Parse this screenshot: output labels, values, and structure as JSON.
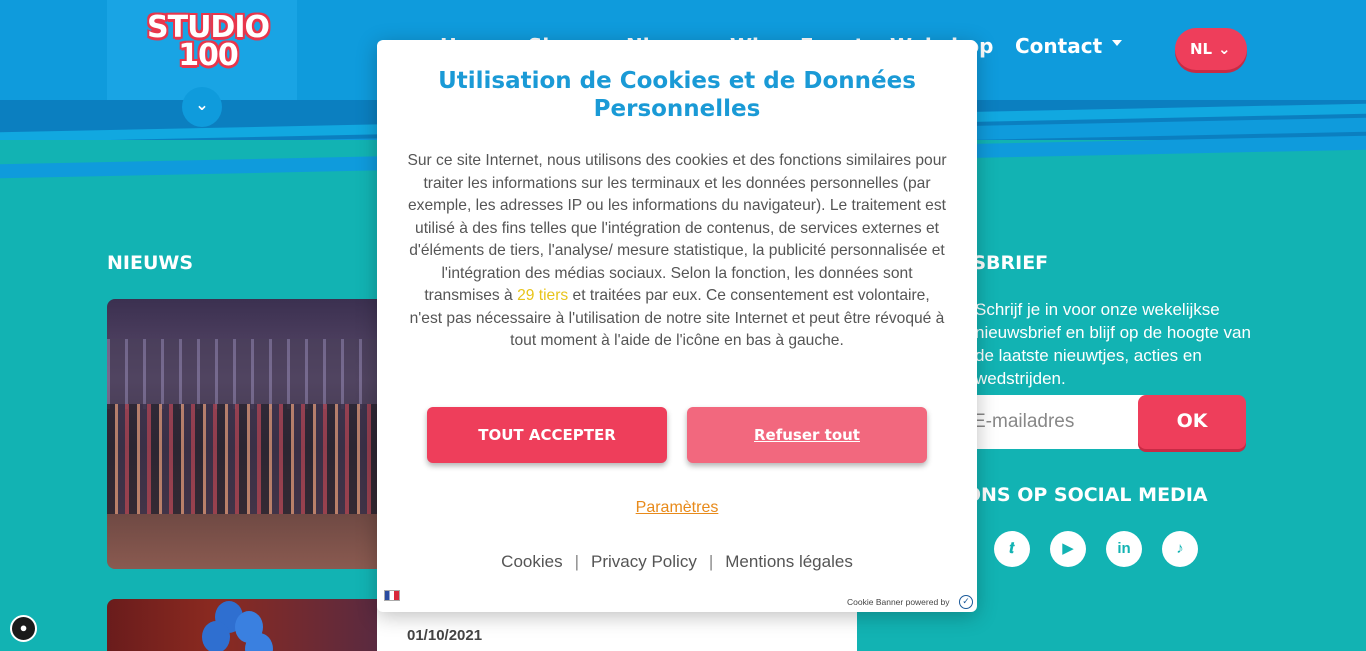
{
  "header": {
    "logo_line1": "STUDIO",
    "logo_line2": "100",
    "nav_items": [
      "Home",
      "Shows",
      "Nieuws",
      "Wie",
      "Events",
      "Webshop",
      "Contact"
    ],
    "lang": "NL"
  },
  "main": {
    "news_title": "NIEUWS",
    "news_date": "01/10/2021",
    "newsletter_title": "NIEUWSBRIEF",
    "newsletter_text": "Schrijf je in voor onze wekelijkse nieuwsbrief en blijf op de hoogte van de laatste nieuwtjes, acties en wedstrijden.",
    "email_placeholder": "E-mailadres",
    "ok_label": "OK",
    "social_title": "VOLG ONS OP SOCIAL MEDIA"
  },
  "cookie_modal": {
    "title": "Utilisation de Cookies et de Données Personnelles",
    "body_part1": "Sur ce site Internet, nous utilisons des cookies et des fonctions similaires pour traiter les informations sur les terminaux et les données personnelles (par exemple, les adresses IP ou les informations du navigateur). Le traitement est utilisé à des fins telles que l'intégration de contenus, de services externes et d'éléments de tiers, l'analyse/ mesure statistique, la publicité personnalisée et l'intégration des médias sociaux. Selon la fonction, les données sont transmises à ",
    "body_link": "29 tiers",
    "body_part2": " et traitées par eux. Ce consentement est volontaire, n'est pas nécessaire à l'utilisation de notre site Internet et peut être révoqué à tout moment à l'aide de l'icône en bas à gauche.",
    "accept_label": "TOUT ACCEPTER",
    "refuse_label": "Refuser tout",
    "params_label": "Paramètres",
    "footer_links": [
      "Cookies",
      "Privacy Policy",
      "Mentions légales"
    ],
    "powered_by": "Cookie Banner powered by"
  },
  "colors": {
    "header_blue": "#0f9bdc",
    "teal_bg": "#12b3b3",
    "accent_red": "#ee3e5b",
    "title_blue": "#1a9ad6",
    "link_yellow": "#e8c41a",
    "link_orange": "#e88a1a"
  },
  "icons": [
    "chevron-down-icon",
    "twitter-icon",
    "youtube-icon",
    "linkedin-icon",
    "tiktok-icon",
    "cookie-icon",
    "french-flag-icon",
    "usercentrics-check-icon"
  ]
}
